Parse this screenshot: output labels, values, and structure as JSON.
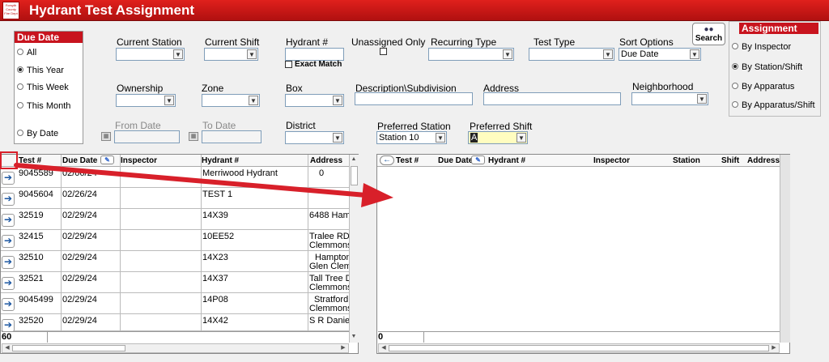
{
  "app": {
    "title": "Hydrant Test Assignment",
    "logo_text": "Forsyth County Fire Dept"
  },
  "due_date": {
    "header": "Due Date",
    "options": [
      {
        "label": "All",
        "selected": false
      },
      {
        "label": "This Year",
        "selected": true
      },
      {
        "label": "This Week",
        "selected": false
      },
      {
        "label": "This Month",
        "selected": false
      },
      {
        "label": "By Date",
        "selected": false
      }
    ]
  },
  "filters": {
    "current_station_label": "Current Station",
    "current_shift_label": "Current Shift",
    "hydrant_label": "Hydrant #",
    "exact_match_label": "Exact Match",
    "unassigned_only_label": "Unassigned Only",
    "recurring_type_label": "Recurring Type",
    "test_type_label": "Test Type",
    "sort_options_label": "Sort Options",
    "sort_options_value": "Due Date",
    "ownership_label": "Ownership",
    "zone_label": "Zone",
    "box_label": "Box",
    "description_label": "Description\\Subdivision",
    "address_label": "Address",
    "neighborhood_label": "Neighborhood",
    "from_date_label": "From Date",
    "to_date_label": "To Date",
    "district_label": "District",
    "preferred_station_label": "Preferred Station",
    "preferred_station_value": "Station 10",
    "preferred_shift_label": "Preferred Shift",
    "preferred_shift_value": "A"
  },
  "search": {
    "label": "Search",
    "icon": "binoculars-icon"
  },
  "assignment": {
    "header": "Assignment",
    "options": [
      {
        "label": "By Inspector",
        "selected": false
      },
      {
        "label": "By Station/Shift",
        "selected": true
      },
      {
        "label": "By Apparatus",
        "selected": false
      },
      {
        "label": "By Apparatus/Shift",
        "selected": false
      }
    ]
  },
  "left_grid": {
    "columns": [
      "Test #",
      "Due Date",
      "Inspector",
      "Hydrant #",
      "Address"
    ],
    "rows": [
      {
        "test": "9045589",
        "due": "02/06/24",
        "inspector": "",
        "hydrant": "Merriwood Hydrant",
        "address": "0",
        "address2": ""
      },
      {
        "test": "9045604",
        "due": "02/26/24",
        "inspector": "",
        "hydrant": "TEST 1",
        "address": "",
        "address2": ""
      },
      {
        "test": "32519",
        "due": "02/29/24",
        "inspector": "",
        "hydrant": "14X39",
        "address": "6488 Ham",
        "address2": ""
      },
      {
        "test": "32415",
        "due": "02/29/24",
        "inspector": "",
        "hydrant": "10EE52",
        "address": "Tralee RD",
        "address2": "Clemmons"
      },
      {
        "test": "32510",
        "due": "02/29/24",
        "inspector": "",
        "hydrant": "14X23",
        "address": "Hampton",
        "address2": "Glen Clem"
      },
      {
        "test": "32521",
        "due": "02/29/24",
        "inspector": "",
        "hydrant": "14X37",
        "address": "Tall Tree D",
        "address2": "Clemmons"
      },
      {
        "test": "9045499",
        "due": "02/29/24",
        "inspector": "",
        "hydrant": "14P08",
        "address": "Stratford",
        "address2": "Clemmons"
      },
      {
        "test": "32520",
        "due": "02/29/24",
        "inspector": "",
        "hydrant": "14X42",
        "address": "S R Danie",
        "address2": ""
      }
    ],
    "count": "60"
  },
  "right_grid": {
    "columns": [
      "Test #",
      "Due Date",
      "Hydrant #",
      "Inspector",
      "Station",
      "Shift",
      "Address"
    ],
    "count": "0"
  },
  "colors": {
    "title_bar": "#c8141e",
    "arrow": "#d8202a",
    "row_arrow": "#1a55a0"
  }
}
